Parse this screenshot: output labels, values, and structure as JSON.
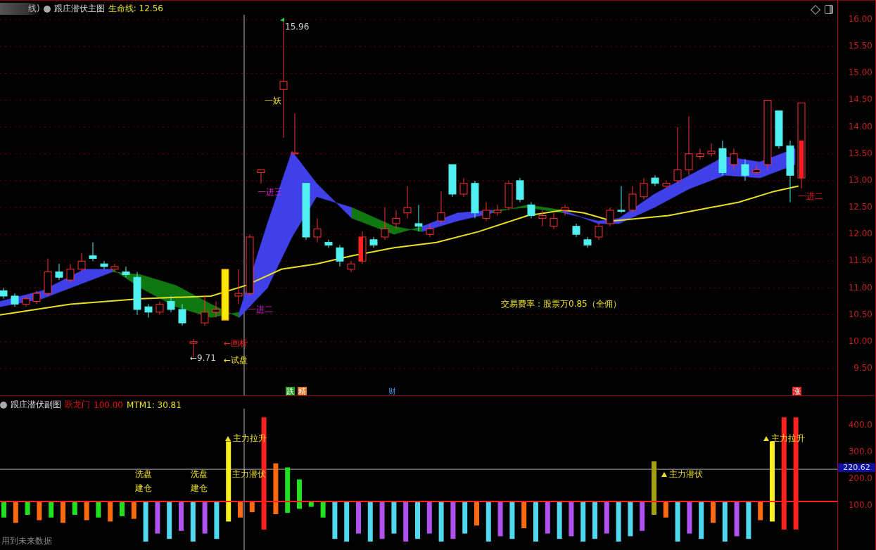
{
  "main_chart": {
    "header": {
      "prefix": "线)",
      "title": "跟庄潜伏主图",
      "indicator": "生命线: 12.56"
    },
    "y_axis": [
      "16.00",
      "15.50",
      "15.00",
      "14.50",
      "14.00",
      "13.50",
      "13.00",
      "12.50",
      "12.00",
      "11.50",
      "11.00",
      "10.50",
      "10.00",
      "9.50"
    ],
    "annotations": [
      {
        "text": "15.96",
        "kind": "price"
      },
      {
        "text": "一妖",
        "kind": "alert"
      },
      {
        "text": "一进三",
        "kind": "entry"
      },
      {
        "text": "一进二",
        "kind": "entry"
      },
      {
        "text": "←画析",
        "kind": "exit"
      },
      {
        "text": "←试盘",
        "kind": "alert"
      },
      {
        "text": "←9.71",
        "kind": "price"
      },
      {
        "text": "交易费率：股票万0.85（全佣）",
        "kind": "alert"
      },
      {
        "text": "一进二",
        "kind": "exit"
      }
    ],
    "event_tags": [
      {
        "text": "跌",
        "kind": "down"
      },
      {
        "text": "精",
        "kind": "pick"
      },
      {
        "text": "财",
        "kind": "finance"
      },
      {
        "text": "涨",
        "kind": "up"
      }
    ]
  },
  "sub_chart": {
    "header": {
      "title": "跟庄潜伏副图",
      "signal_name": "跃龙门",
      "signal_value": "100.00",
      "indicator": "MTM1: 30.81"
    },
    "y_axis": [
      "400.0",
      "300.0",
      "200.0",
      "100.0"
    ],
    "current_value": "220.62",
    "labels": [
      {
        "text": "主力拉升",
        "kind": "marker"
      },
      {
        "text": "洗盘",
        "kind": "plain"
      },
      {
        "text": "建仓",
        "kind": "plain"
      },
      {
        "text": "洗盘",
        "kind": "plain"
      },
      {
        "text": "建仓",
        "kind": "plain"
      },
      {
        "text": "主力潜伏",
        "kind": "plain"
      },
      {
        "text": "主力潜伏",
        "kind": "marker"
      },
      {
        "text": "主力拉升",
        "kind": "marker"
      }
    ],
    "footer_note": "用到未来数据"
  }
}
